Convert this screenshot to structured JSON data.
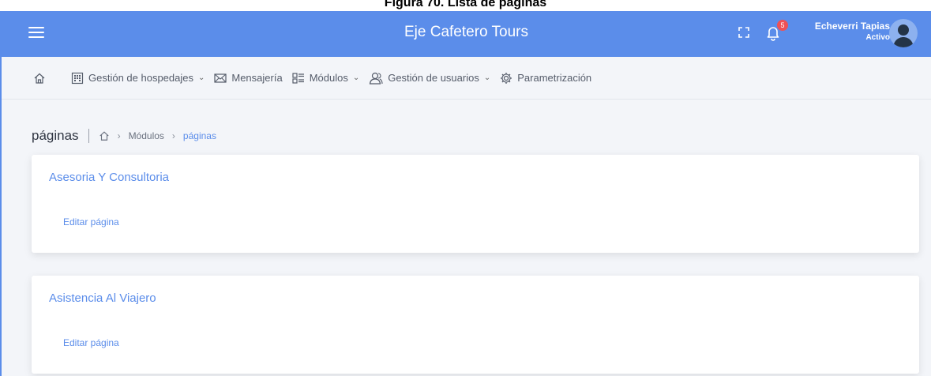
{
  "figure_caption": "Figura 70. Lista de páginas",
  "header": {
    "title": "Eje Cafetero Tours",
    "notification_count": "5",
    "user_name": "Echeverri Tapias",
    "user_status": "Activo"
  },
  "nav": {
    "items": [
      {
        "label": "Gestión de hospedajes",
        "icon": "building-icon",
        "dropdown": true
      },
      {
        "label": "Mensajería",
        "icon": "envelope-icon",
        "dropdown": false
      },
      {
        "label": "Módulos",
        "icon": "modules-icon",
        "dropdown": true
      },
      {
        "label": "Gestión de usuarios",
        "icon": "users-icon",
        "dropdown": true
      },
      {
        "label": "Parametrización",
        "icon": "gear-icon",
        "dropdown": false
      }
    ]
  },
  "breadcrumb": {
    "heading": "páginas",
    "parent": "Módulos",
    "current": "páginas",
    "arrow": "›"
  },
  "cards": [
    {
      "title": "Asesoria Y Consultoria",
      "action": "Editar página"
    },
    {
      "title": "Asistencia Al Viajero",
      "action": "Editar página"
    }
  ],
  "colors": {
    "primary": "#5b8dea",
    "badge": "#f05154",
    "background": "#f3f5f9"
  }
}
